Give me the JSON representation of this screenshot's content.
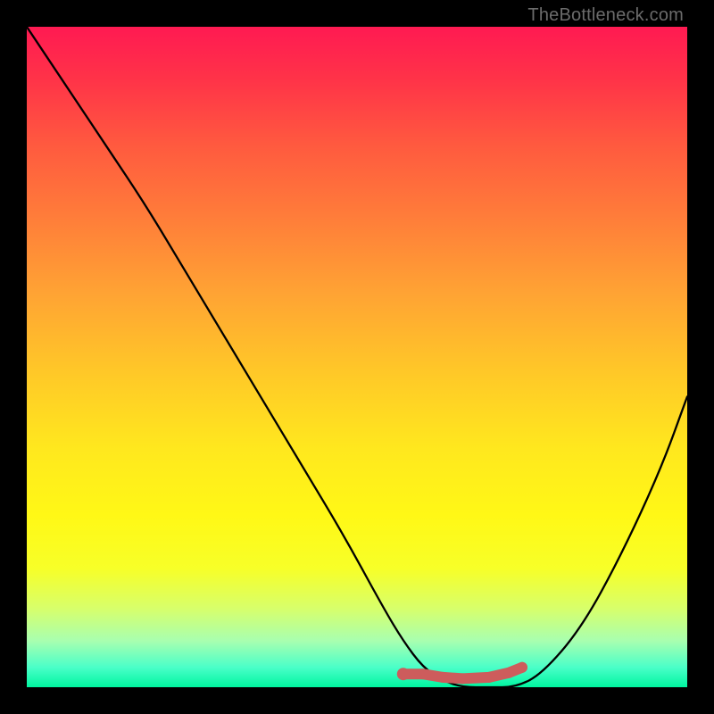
{
  "watermark": "TheBottleneck.com",
  "chart_data": {
    "type": "line",
    "title": "",
    "xlabel": "",
    "ylabel": "",
    "xlim": [
      0,
      100
    ],
    "ylim": [
      0,
      100
    ],
    "series": [
      {
        "name": "bottleneck-curve",
        "x": [
          0,
          6,
          12,
          18,
          24,
          30,
          36,
          42,
          48,
          54,
          57,
          60,
          63,
          66,
          70,
          74,
          78,
          84,
          90,
          96,
          100
        ],
        "y": [
          100,
          91,
          82,
          73,
          63,
          53,
          43,
          33,
          23,
          12,
          7,
          3,
          1,
          0,
          0,
          0,
          2,
          9,
          20,
          33,
          44
        ]
      }
    ],
    "highlight_segment": {
      "name": "optimal-range",
      "x": [
        57,
        60,
        63,
        66,
        70,
        73,
        75
      ],
      "y": [
        2,
        2,
        1.5,
        1.3,
        1.5,
        2.2,
        3
      ],
      "color": "#cd5c5c"
    },
    "background": "rainbow-gradient (red top → green bottom)"
  }
}
